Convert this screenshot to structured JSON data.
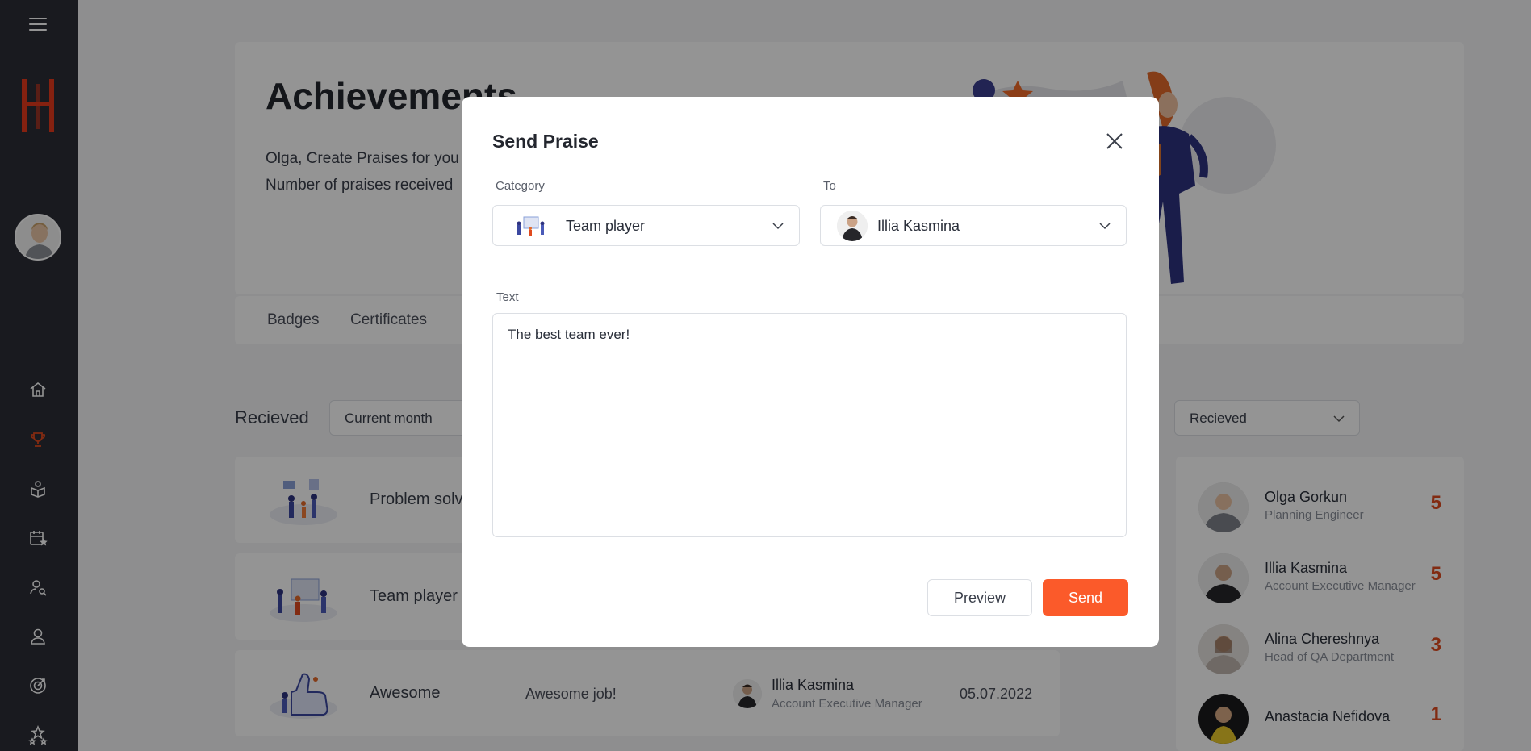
{
  "sidebar": {
    "icons": [
      "menu-icon",
      "home-icon",
      "trophy-icon",
      "education-icon",
      "calendar-star-icon",
      "user-search-icon",
      "user-icon",
      "target-icon",
      "stars-icon"
    ],
    "active_color": "#e04a1f"
  },
  "page": {
    "title": "Achievements",
    "subtitle1": "Olga, Create Praises for you",
    "subtitle2": "Number of praises received",
    "tabs": [
      "Badges",
      "Certificates"
    ],
    "section_label": "Recieved",
    "filter_period": "Current month",
    "filter_type": "Recieved",
    "rows": [
      {
        "name": "Problem solv",
        "text": "",
        "person": "",
        "role": "",
        "date": ""
      },
      {
        "name": "Team player",
        "text": "",
        "person": "",
        "role": "",
        "date": ""
      },
      {
        "name": "Awesome",
        "text": "Awesome job!",
        "person": "Illia Kasmina",
        "role": "Account Executive Manager",
        "date": "05.07.2022"
      }
    ],
    "leaders": [
      {
        "name": "Olga Gorkun",
        "role": "Planning Engineer",
        "count": "5"
      },
      {
        "name": "Illia Kasmina",
        "role": "Account Executive Manager",
        "count": "5"
      },
      {
        "name": "Alina Chereshnya",
        "role": "Head of QA Department",
        "count": "3"
      },
      {
        "name": "Anastacia Nefidova",
        "role": "",
        "count": "1"
      }
    ]
  },
  "modal": {
    "title": "Send Praise",
    "category_label": "Category",
    "category_value": "Team player",
    "to_label": "To",
    "to_value": "Illia Kasmina",
    "text_label": "Text",
    "text_value": "The best team ever!",
    "preview_label": "Preview",
    "send_label": "Send",
    "accent": "#fb5a2a"
  }
}
